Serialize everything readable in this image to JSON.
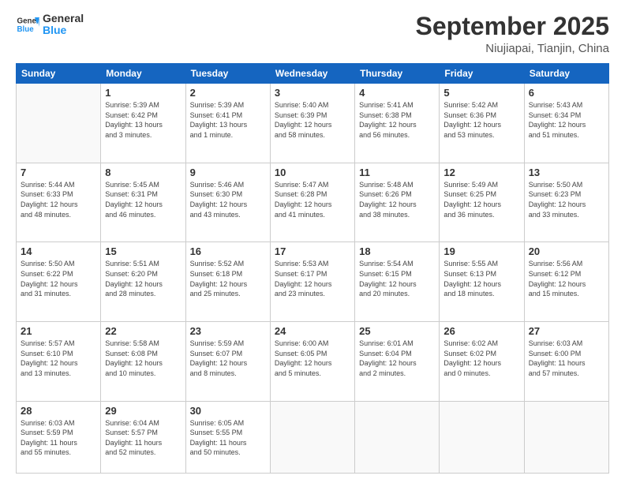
{
  "logo": {
    "line1": "General",
    "line2": "Blue"
  },
  "title": "September 2025",
  "subtitle": "Niujiapai, Tianjin, China",
  "days_of_week": [
    "Sunday",
    "Monday",
    "Tuesday",
    "Wednesday",
    "Thursday",
    "Friday",
    "Saturday"
  ],
  "weeks": [
    [
      {
        "day": "",
        "info": ""
      },
      {
        "day": "1",
        "info": "Sunrise: 5:39 AM\nSunset: 6:42 PM\nDaylight: 13 hours\nand 3 minutes."
      },
      {
        "day": "2",
        "info": "Sunrise: 5:39 AM\nSunset: 6:41 PM\nDaylight: 13 hours\nand 1 minute."
      },
      {
        "day": "3",
        "info": "Sunrise: 5:40 AM\nSunset: 6:39 PM\nDaylight: 12 hours\nand 58 minutes."
      },
      {
        "day": "4",
        "info": "Sunrise: 5:41 AM\nSunset: 6:38 PM\nDaylight: 12 hours\nand 56 minutes."
      },
      {
        "day": "5",
        "info": "Sunrise: 5:42 AM\nSunset: 6:36 PM\nDaylight: 12 hours\nand 53 minutes."
      },
      {
        "day": "6",
        "info": "Sunrise: 5:43 AM\nSunset: 6:34 PM\nDaylight: 12 hours\nand 51 minutes."
      }
    ],
    [
      {
        "day": "7",
        "info": "Sunrise: 5:44 AM\nSunset: 6:33 PM\nDaylight: 12 hours\nand 48 minutes."
      },
      {
        "day": "8",
        "info": "Sunrise: 5:45 AM\nSunset: 6:31 PM\nDaylight: 12 hours\nand 46 minutes."
      },
      {
        "day": "9",
        "info": "Sunrise: 5:46 AM\nSunset: 6:30 PM\nDaylight: 12 hours\nand 43 minutes."
      },
      {
        "day": "10",
        "info": "Sunrise: 5:47 AM\nSunset: 6:28 PM\nDaylight: 12 hours\nand 41 minutes."
      },
      {
        "day": "11",
        "info": "Sunrise: 5:48 AM\nSunset: 6:26 PM\nDaylight: 12 hours\nand 38 minutes."
      },
      {
        "day": "12",
        "info": "Sunrise: 5:49 AM\nSunset: 6:25 PM\nDaylight: 12 hours\nand 36 minutes."
      },
      {
        "day": "13",
        "info": "Sunrise: 5:50 AM\nSunset: 6:23 PM\nDaylight: 12 hours\nand 33 minutes."
      }
    ],
    [
      {
        "day": "14",
        "info": "Sunrise: 5:50 AM\nSunset: 6:22 PM\nDaylight: 12 hours\nand 31 minutes."
      },
      {
        "day": "15",
        "info": "Sunrise: 5:51 AM\nSunset: 6:20 PM\nDaylight: 12 hours\nand 28 minutes."
      },
      {
        "day": "16",
        "info": "Sunrise: 5:52 AM\nSunset: 6:18 PM\nDaylight: 12 hours\nand 25 minutes."
      },
      {
        "day": "17",
        "info": "Sunrise: 5:53 AM\nSunset: 6:17 PM\nDaylight: 12 hours\nand 23 minutes."
      },
      {
        "day": "18",
        "info": "Sunrise: 5:54 AM\nSunset: 6:15 PM\nDaylight: 12 hours\nand 20 minutes."
      },
      {
        "day": "19",
        "info": "Sunrise: 5:55 AM\nSunset: 6:13 PM\nDaylight: 12 hours\nand 18 minutes."
      },
      {
        "day": "20",
        "info": "Sunrise: 5:56 AM\nSunset: 6:12 PM\nDaylight: 12 hours\nand 15 minutes."
      }
    ],
    [
      {
        "day": "21",
        "info": "Sunrise: 5:57 AM\nSunset: 6:10 PM\nDaylight: 12 hours\nand 13 minutes."
      },
      {
        "day": "22",
        "info": "Sunrise: 5:58 AM\nSunset: 6:08 PM\nDaylight: 12 hours\nand 10 minutes."
      },
      {
        "day": "23",
        "info": "Sunrise: 5:59 AM\nSunset: 6:07 PM\nDaylight: 12 hours\nand 8 minutes."
      },
      {
        "day": "24",
        "info": "Sunrise: 6:00 AM\nSunset: 6:05 PM\nDaylight: 12 hours\nand 5 minutes."
      },
      {
        "day": "25",
        "info": "Sunrise: 6:01 AM\nSunset: 6:04 PM\nDaylight: 12 hours\nand 2 minutes."
      },
      {
        "day": "26",
        "info": "Sunrise: 6:02 AM\nSunset: 6:02 PM\nDaylight: 12 hours\nand 0 minutes."
      },
      {
        "day": "27",
        "info": "Sunrise: 6:03 AM\nSunset: 6:00 PM\nDaylight: 11 hours\nand 57 minutes."
      }
    ],
    [
      {
        "day": "28",
        "info": "Sunrise: 6:03 AM\nSunset: 5:59 PM\nDaylight: 11 hours\nand 55 minutes."
      },
      {
        "day": "29",
        "info": "Sunrise: 6:04 AM\nSunset: 5:57 PM\nDaylight: 11 hours\nand 52 minutes."
      },
      {
        "day": "30",
        "info": "Sunrise: 6:05 AM\nSunset: 5:55 PM\nDaylight: 11 hours\nand 50 minutes."
      },
      {
        "day": "",
        "info": ""
      },
      {
        "day": "",
        "info": ""
      },
      {
        "day": "",
        "info": ""
      },
      {
        "day": "",
        "info": ""
      }
    ]
  ]
}
